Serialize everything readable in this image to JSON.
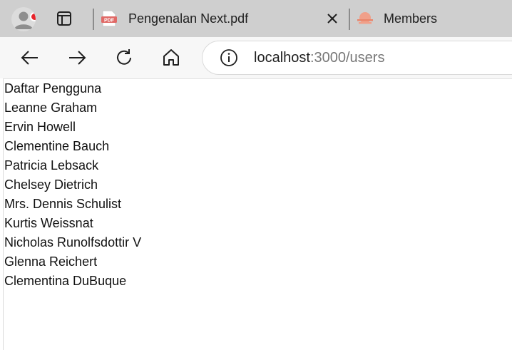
{
  "browser": {
    "tabs": [
      {
        "title": "Pengenalan Next.pdf",
        "icon": "pdf-icon"
      },
      {
        "title": "Members",
        "icon": "site-favicon-icon"
      }
    ],
    "address": {
      "host": "localhost",
      "path": ":3000/users"
    }
  },
  "page": {
    "heading": "Daftar Pengguna",
    "users": [
      "Leanne Graham",
      "Ervin Howell",
      "Clementine Bauch",
      "Patricia Lebsack",
      "Chelsey Dietrich",
      "Mrs. Dennis Schulist",
      "Kurtis Weissnat",
      "Nicholas Runolfsdottir V",
      "Glenna Reichert",
      "Clementina DuBuque"
    ]
  }
}
